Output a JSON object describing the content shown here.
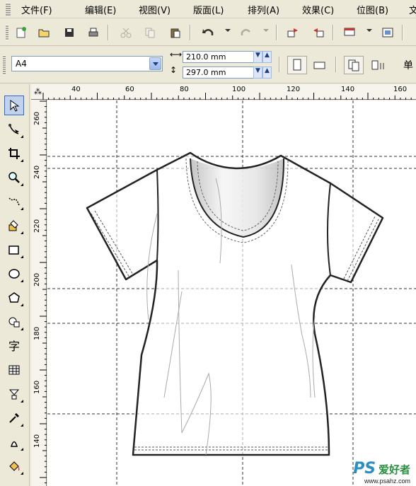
{
  "menu": {
    "items": [
      "文件(F)",
      "编辑(E)",
      "视图(V)",
      "版面(L)",
      "排列(A)",
      "效果(C)",
      "位图(B)",
      "文"
    ]
  },
  "properties": {
    "page_size": "A4",
    "width": "210.0 mm",
    "height": "297.0 mm",
    "units_label": "单"
  },
  "ruler": {
    "h_labels": [
      "40",
      "60",
      "80",
      "100",
      "120",
      "140",
      "160"
    ],
    "v_labels": [
      "260",
      "240",
      "220",
      "200",
      "180",
      "160",
      "140"
    ]
  },
  "watermark": {
    "main": "PS",
    "cn": "爱好者",
    "url": "www.psahz.com"
  },
  "colors": {
    "chrome": "#ece9d8",
    "canvas": "#ffffff",
    "accent": "#316ac5"
  }
}
